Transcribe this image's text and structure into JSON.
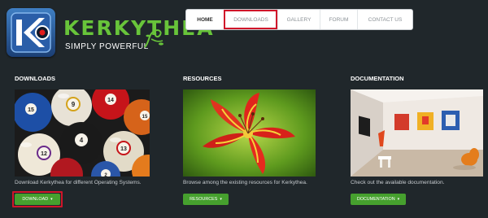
{
  "logo": {
    "title": "KERKYTHEA",
    "tagline": "SIMPLY POWERFUL"
  },
  "nav": {
    "items": [
      {
        "label": "HOME"
      },
      {
        "label": "DOWNLOADS"
      },
      {
        "label": "GALLERY"
      },
      {
        "label": "FORUM"
      },
      {
        "label": "CONTACT US"
      }
    ]
  },
  "sections": {
    "downloads": {
      "heading": "DOWNLOADS",
      "description": "Download Kerkythea for different Operating Systems.",
      "button": "DOWNLOAD"
    },
    "resources": {
      "heading": "RESOURCES",
      "description": "Browse among the existing resources for Kerkythea.",
      "button": "RESOURCES"
    },
    "documentation": {
      "heading": "DOCUMENTATION",
      "description": "Check out the available documentation.",
      "button": "DOCUMENTATION"
    }
  },
  "billiard_numbers": [
    "15",
    "9",
    "14",
    "4",
    "12",
    "13",
    "2",
    "15"
  ],
  "colors": {
    "background": "#20272b",
    "brand_green": "#68c43a",
    "button_green": "#46a02e",
    "highlight_red": "#d0152a"
  }
}
